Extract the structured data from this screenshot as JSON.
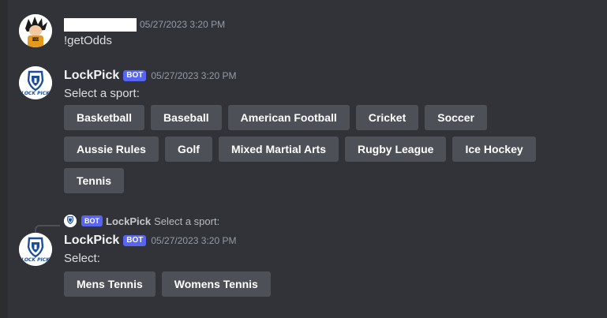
{
  "messages": [
    {
      "timestamp": "05/27/2023 3:20 PM",
      "text": "!getOdds"
    },
    {
      "author": "LockPick",
      "badge": "BOT",
      "timestamp": "05/27/2023 3:20 PM",
      "text": "Select a sport:",
      "buttons": [
        "Basketball",
        "Baseball",
        "American Football",
        "Cricket",
        "Soccer",
        "Aussie Rules",
        "Golf",
        "Mixed Martial Arts",
        "Rugby League",
        "Ice Hockey",
        "Tennis"
      ]
    },
    {
      "reply": {
        "badge": "BOT",
        "author": "LockPick",
        "text": "Select a sport:"
      },
      "author": "LockPick",
      "badge": "BOT",
      "timestamp": "05/27/2023 3:20 PM",
      "text": "Select:",
      "buttons": [
        "Mens Tennis",
        "Womens Tennis"
      ]
    }
  ],
  "logo_text": "LOCK PICK",
  "colors": {
    "background": "#313338",
    "button": "#4e5058",
    "bot_badge": "#5865f2",
    "timestamp": "#949ba4"
  }
}
